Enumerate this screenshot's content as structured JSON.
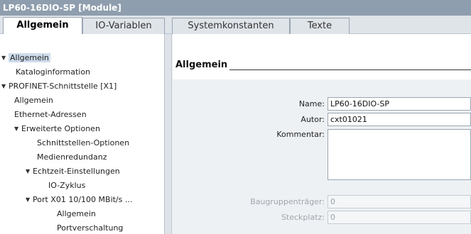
{
  "window": {
    "title": "LP60-16DIO-SP [Module]"
  },
  "tabs": [
    {
      "label": "Allgemein",
      "active": true
    },
    {
      "label": "IO-Variablen",
      "active": false
    },
    {
      "label": "Systemkonstanten",
      "active": false
    },
    {
      "label": "Texte",
      "active": false
    }
  ],
  "tree": [
    {
      "label": "Allgemein",
      "expandable": true,
      "selected": true
    },
    {
      "label": "Kataloginformation",
      "expandable": false
    },
    {
      "label": "PROFINET-Schnittstelle [X1]",
      "expandable": true
    },
    {
      "label": "Allgemein",
      "expandable": false
    },
    {
      "label": "Ethernet-Adressen",
      "expandable": false
    },
    {
      "label": "Erweiterte Optionen",
      "expandable": true
    },
    {
      "label": "Schnittstellen-Optionen",
      "expandable": false
    },
    {
      "label": "Medienredundanz",
      "expandable": false
    },
    {
      "label": "Echtzeit-Einstellungen",
      "expandable": true
    },
    {
      "label": "IO-Zyklus",
      "expandable": false
    },
    {
      "label": "Port X01 10/100 MBit/s ...",
      "expandable": true
    },
    {
      "label": "Allgemein",
      "expandable": false
    },
    {
      "label": "Portverschaltung",
      "expandable": false
    }
  ],
  "section": {
    "title": "Allgemein"
  },
  "form": {
    "name_label": "Name:",
    "name_value": "LP60-16DIO-SP",
    "author_label": "Autor:",
    "author_value": "cxt01021",
    "comment_label": "Kommentar:",
    "comment_value": "",
    "rack_label": "Baugruppenträger:",
    "rack_value": "0",
    "slot_label": "Steckplatz:",
    "slot_value": "0"
  }
}
